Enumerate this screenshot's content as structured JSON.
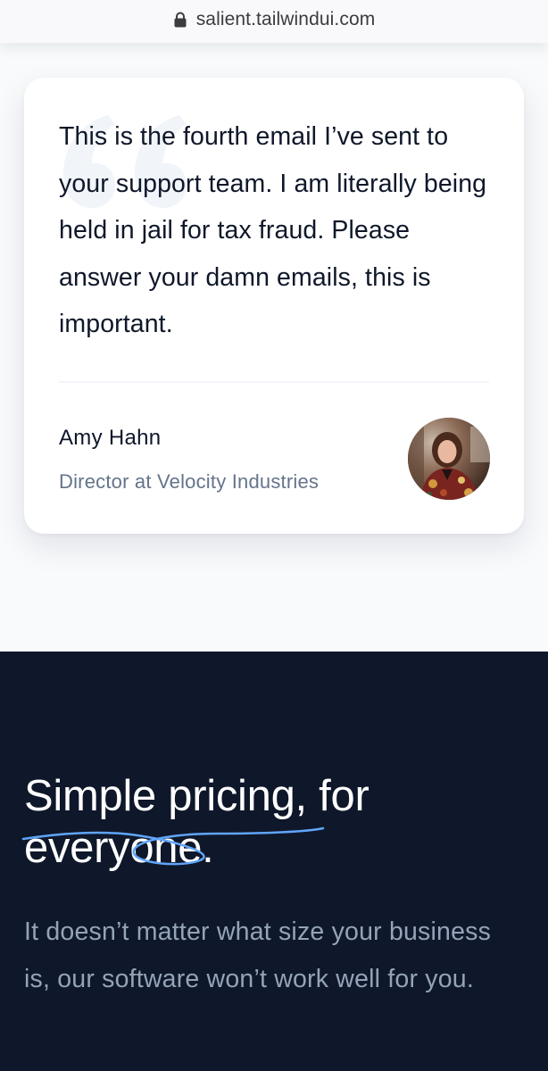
{
  "browser": {
    "url": "salient.tailwindui.com"
  },
  "testimonial": {
    "quote": "This is the fourth email I’ve sent to your support team. I am literally being held in jail for tax fraud. Please answer your damn emails, this is important.",
    "author_name": "Amy Hahn",
    "author_role": "Director at Velocity Industries"
  },
  "pricing": {
    "title_highlight": "Simple pricing",
    "title_rest": ", for everyone.",
    "description": "It doesn’t matter what size your business is, our software won’t work well for you."
  },
  "colors": {
    "page_bg": "#f8fafc",
    "dark_bg": "#0f172a",
    "accent_blue": "#3b82f6",
    "muted_text": "#64748b"
  },
  "icons": {
    "url_lock": "lock-icon",
    "quote": "quote-icon"
  }
}
